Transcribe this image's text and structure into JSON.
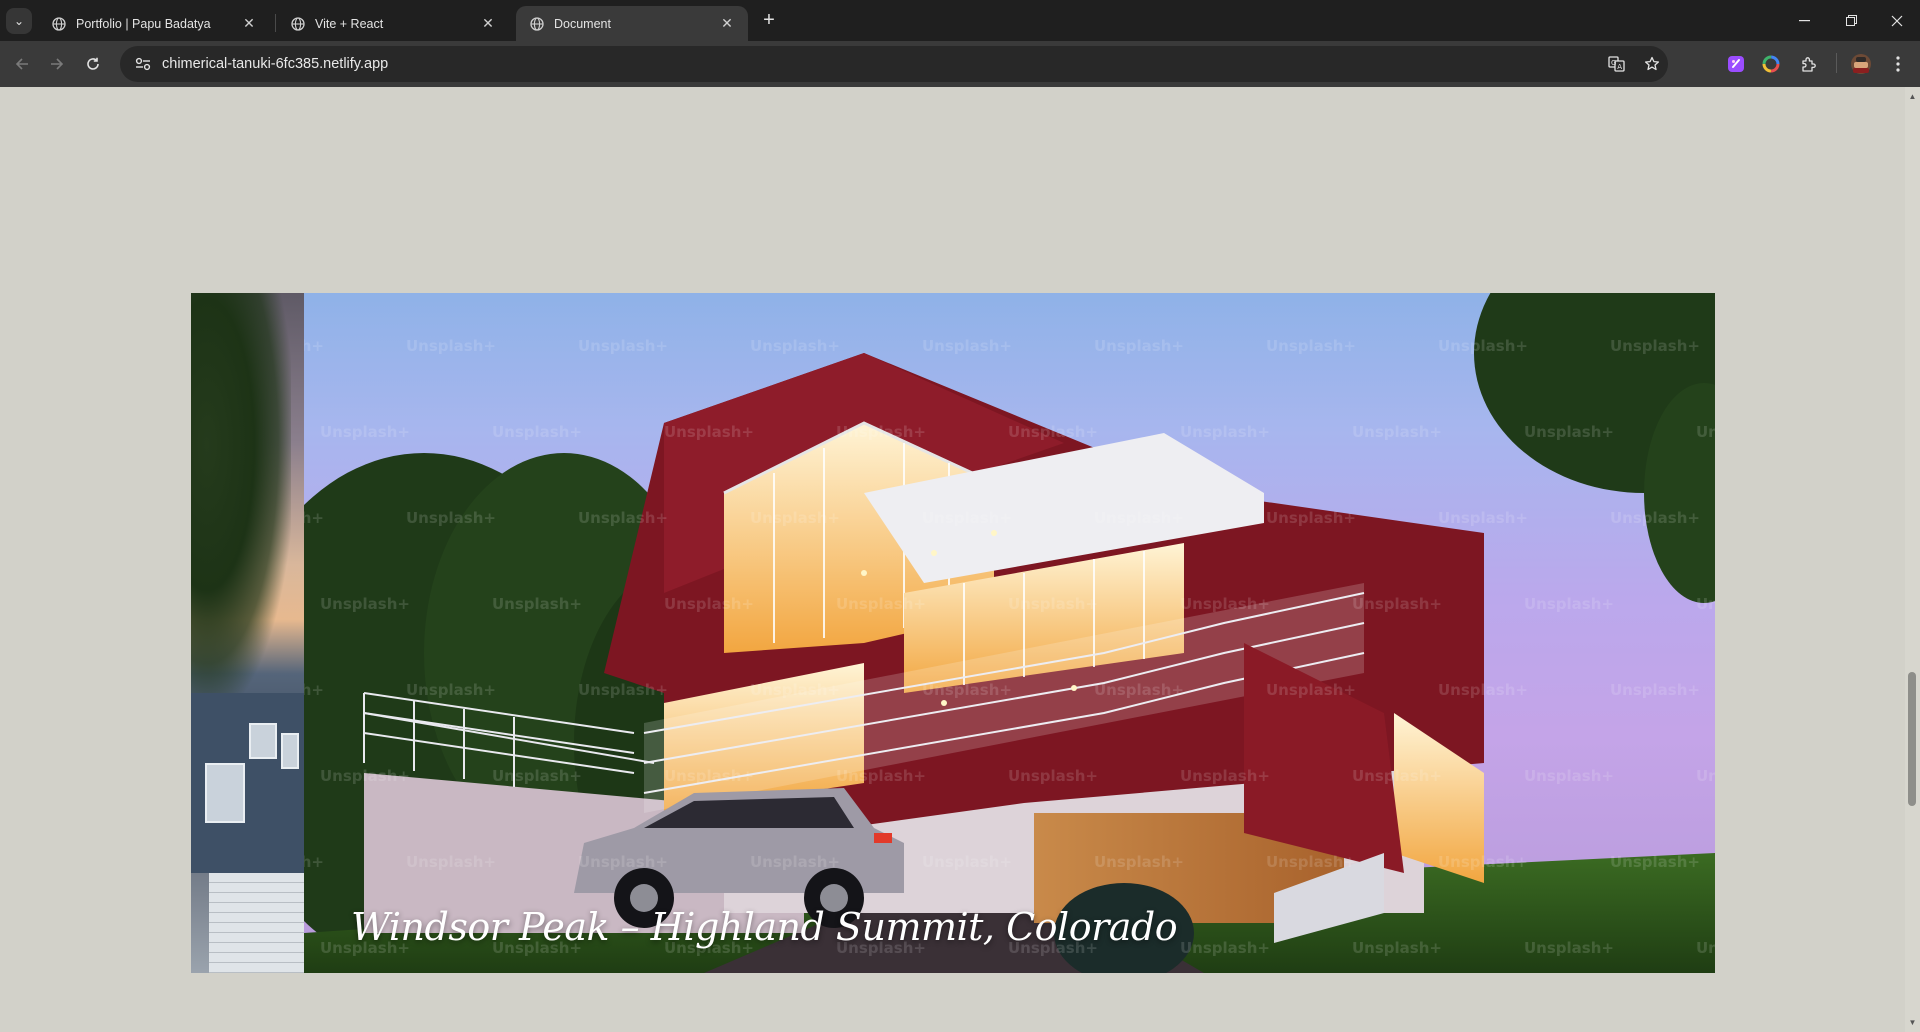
{
  "browser": {
    "tabs": [
      {
        "title": "Portfolio | Papu Badatya",
        "active": false,
        "favicon": "globe-icon"
      },
      {
        "title": "Vite + React",
        "active": false,
        "favicon": "globe-icon"
      },
      {
        "title": "Document",
        "active": true,
        "favicon": "globe-icon"
      }
    ],
    "url": "chimerical-tanuki-6fc385.netlify.app",
    "icons": [
      "tab-search-icon",
      "back-icon",
      "forward-icon",
      "reload-icon",
      "site-info-icon",
      "translate-icon",
      "bookmark-star-icon",
      "extension-app-icon",
      "color-wheel-extension-icon",
      "extensions-puzzle-icon",
      "profile-avatar-icon",
      "menu-dots-icon",
      "minimize-icon",
      "restore-icon",
      "close-window-icon",
      "new-tab-icon"
    ]
  },
  "slider": {
    "caption": "Windsor Peak – Highland Summit, Colorado",
    "watermark": "Unsplash+"
  },
  "colors": {
    "page_background": "#d2d1c9",
    "chrome_dark": "#1f1f1f",
    "chrome_toolbar": "#3a3a3a"
  }
}
